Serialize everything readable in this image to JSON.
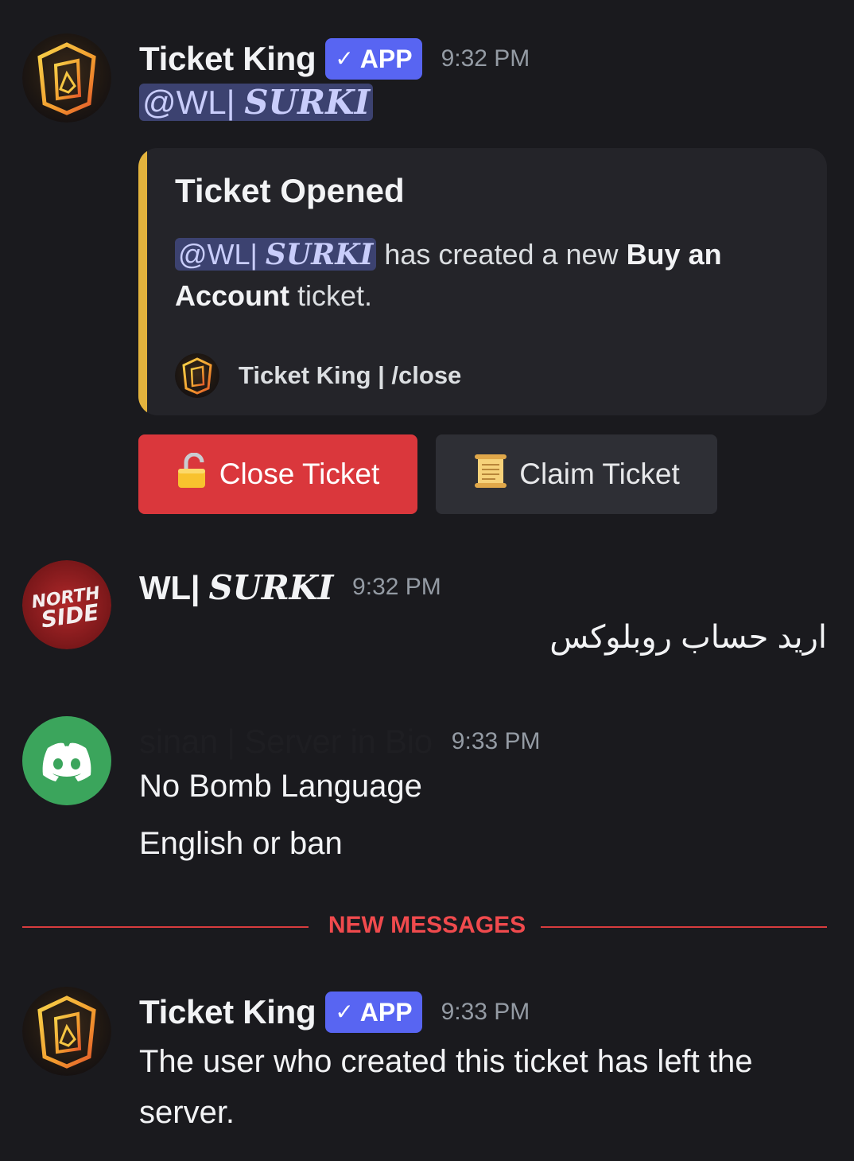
{
  "messages": [
    {
      "username": "Ticket King",
      "badge": "APP",
      "timestamp": "9:32 PM",
      "mention": {
        "prefix": "@WL| ",
        "name": "SURKI"
      },
      "embed": {
        "title": "Ticket Opened",
        "mention": {
          "prefix": "@WL| ",
          "name": "SURKI"
        },
        "desc_part1": " has created a new ",
        "desc_bold": "Buy an Account",
        "desc_part2": " ticket.",
        "footer": "Ticket King | /close",
        "accent_color": "#e3b33d"
      },
      "buttons": [
        {
          "icon": "unlocked-padlock-icon",
          "label": "Close Ticket",
          "color": "#da373c"
        },
        {
          "icon": "scroll-icon",
          "label": "Claim Ticket",
          "color": "#2e2f35"
        }
      ]
    },
    {
      "username_prefix": "WL| ",
      "username_name": "SURKI",
      "avatar_text": "NORTH SIDE",
      "timestamp": "9:32 PM",
      "text": "اريد حساب روبلوكس"
    },
    {
      "username": "sinan | Server in Bio",
      "timestamp": "9:33 PM",
      "lines": [
        "No Bomb Language",
        "English or ban"
      ],
      "avatar_color": "#3ba55c"
    },
    {
      "username": "Ticket King",
      "badge": "APP",
      "timestamp": "9:33 PM",
      "text": "The user who created this ticket has left the server."
    }
  ],
  "divider": {
    "label": "NEW MESSAGES",
    "color": "#f04a4d"
  },
  "colors": {
    "background": "#1a1a1e",
    "mention_bg": "#3c4270",
    "blurple": "#5865f2"
  }
}
